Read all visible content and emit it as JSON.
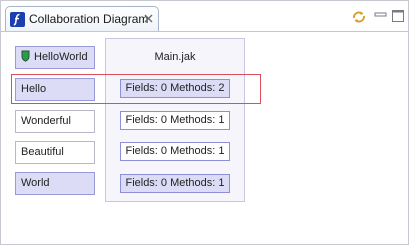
{
  "editor": {
    "tab_title": "Collaboration Diagram",
    "icons": {
      "tab": "featureide-diagram-icon",
      "close": "close-icon",
      "sync": "sync-icon",
      "minimize": "minimize-icon",
      "maximize": "maximize-icon"
    }
  },
  "diagram": {
    "class_name": "Main.jak",
    "features": [
      {
        "label": "HelloWorld",
        "style": "filled",
        "icon": "shield-icon"
      },
      {
        "label": "Hello",
        "style": "filled"
      },
      {
        "label": "Wonderful",
        "style": "plain"
      },
      {
        "label": "Beautiful",
        "style": "plain"
      },
      {
        "label": "World",
        "style": "filled"
      }
    ],
    "roles": [
      {
        "label": "Fields: 0 Methods: 2",
        "style": "filled"
      },
      {
        "label": "Fields: 0 Methods: 1",
        "style": "plain"
      },
      {
        "label": "Fields: 0 Methods: 1",
        "style": "plain"
      },
      {
        "label": "Fields: 0 Methods: 1",
        "style": "filled"
      }
    ],
    "highlight_color": "#d9505a"
  }
}
